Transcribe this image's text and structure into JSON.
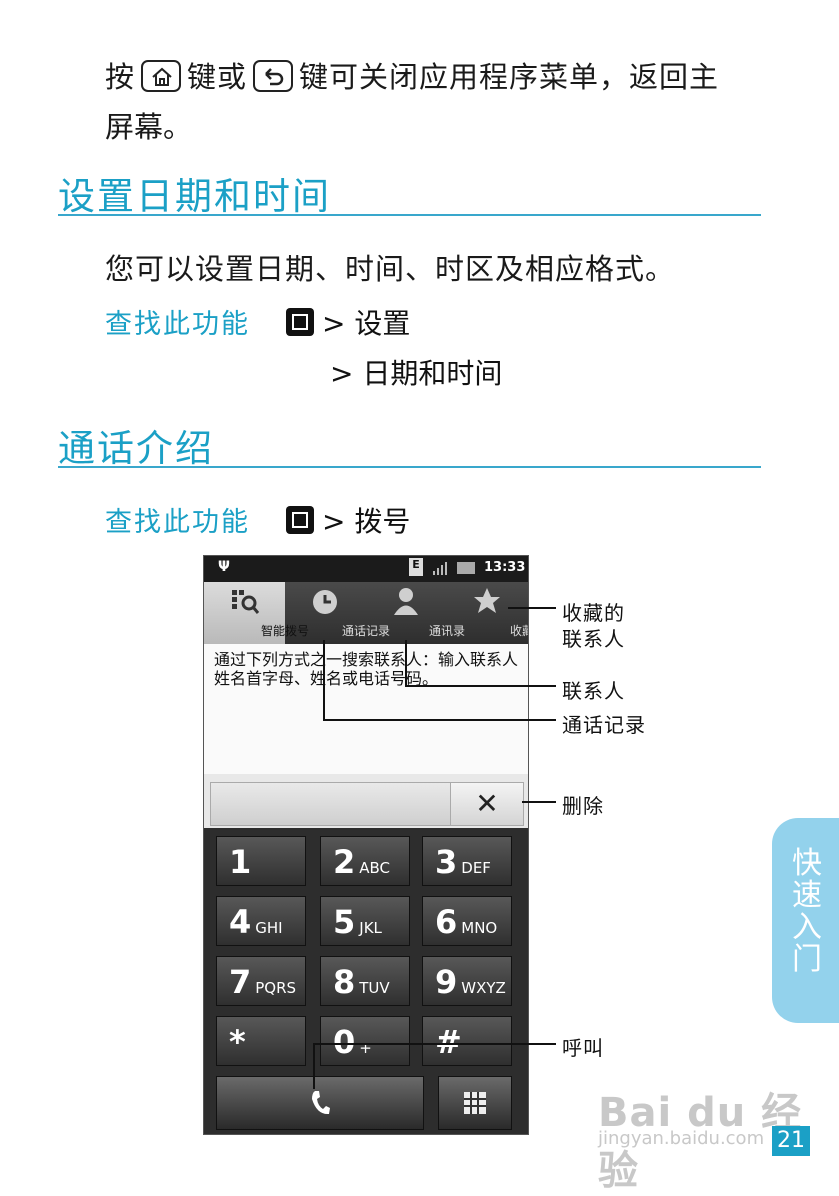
{
  "intro": {
    "part1": "按",
    "part2": "键或",
    "part3": "键可关闭应用程序菜单，返回主",
    "line2": "屏幕。"
  },
  "section_date": {
    "title": "设置日期和时间",
    "body": "您可以设置日期、时间、时区及相应格式。",
    "find_label": "查找此功能",
    "path1": "> 设置",
    "path2": "> 日期和时间"
  },
  "section_call": {
    "title": "通话介绍",
    "find_label": "查找此功能",
    "path1": "> 拨号"
  },
  "phone": {
    "time": "13:33",
    "network": "E",
    "tabs": [
      {
        "label": "智能拨号",
        "icon": "smart-dial-icon"
      },
      {
        "label": "通话记录",
        "icon": "clock-icon"
      },
      {
        "label": "通讯录",
        "icon": "person-icon"
      },
      {
        "label": "收藏夹",
        "icon": "star-icon"
      }
    ],
    "hint": "通过下列方式之一搜索联系人：输入联系人姓名首字母、姓名或电话号码。",
    "delete_glyph": "✕",
    "keys": [
      {
        "digit": "1",
        "letters": ""
      },
      {
        "digit": "2",
        "letters": "ABC"
      },
      {
        "digit": "3",
        "letters": "DEF"
      },
      {
        "digit": "4",
        "letters": "GHI"
      },
      {
        "digit": "5",
        "letters": "JKL"
      },
      {
        "digit": "6",
        "letters": "MNO"
      },
      {
        "digit": "7",
        "letters": "PQRS"
      },
      {
        "digit": "8",
        "letters": "TUV"
      },
      {
        "digit": "9",
        "letters": "WXYZ"
      },
      {
        "digit": "*",
        "letters": ""
      },
      {
        "digit": "0",
        "letters": "+"
      },
      {
        "digit": "#",
        "letters": ""
      }
    ]
  },
  "callouts": {
    "favorites_line1": "收藏的",
    "favorites_line2": "联系人",
    "contacts": "联系人",
    "call_log": "通话记录",
    "delete": "删除",
    "call": "呼叫"
  },
  "side_tab": [
    "快",
    "速",
    "入",
    "门"
  ],
  "page_number": "21",
  "watermark": {
    "line1": "Bai du 经验",
    "line2": "jingyan.baidu.com"
  },
  "colors": {
    "accent": "#1ba0c6",
    "side_tab": "#93d2ec"
  }
}
